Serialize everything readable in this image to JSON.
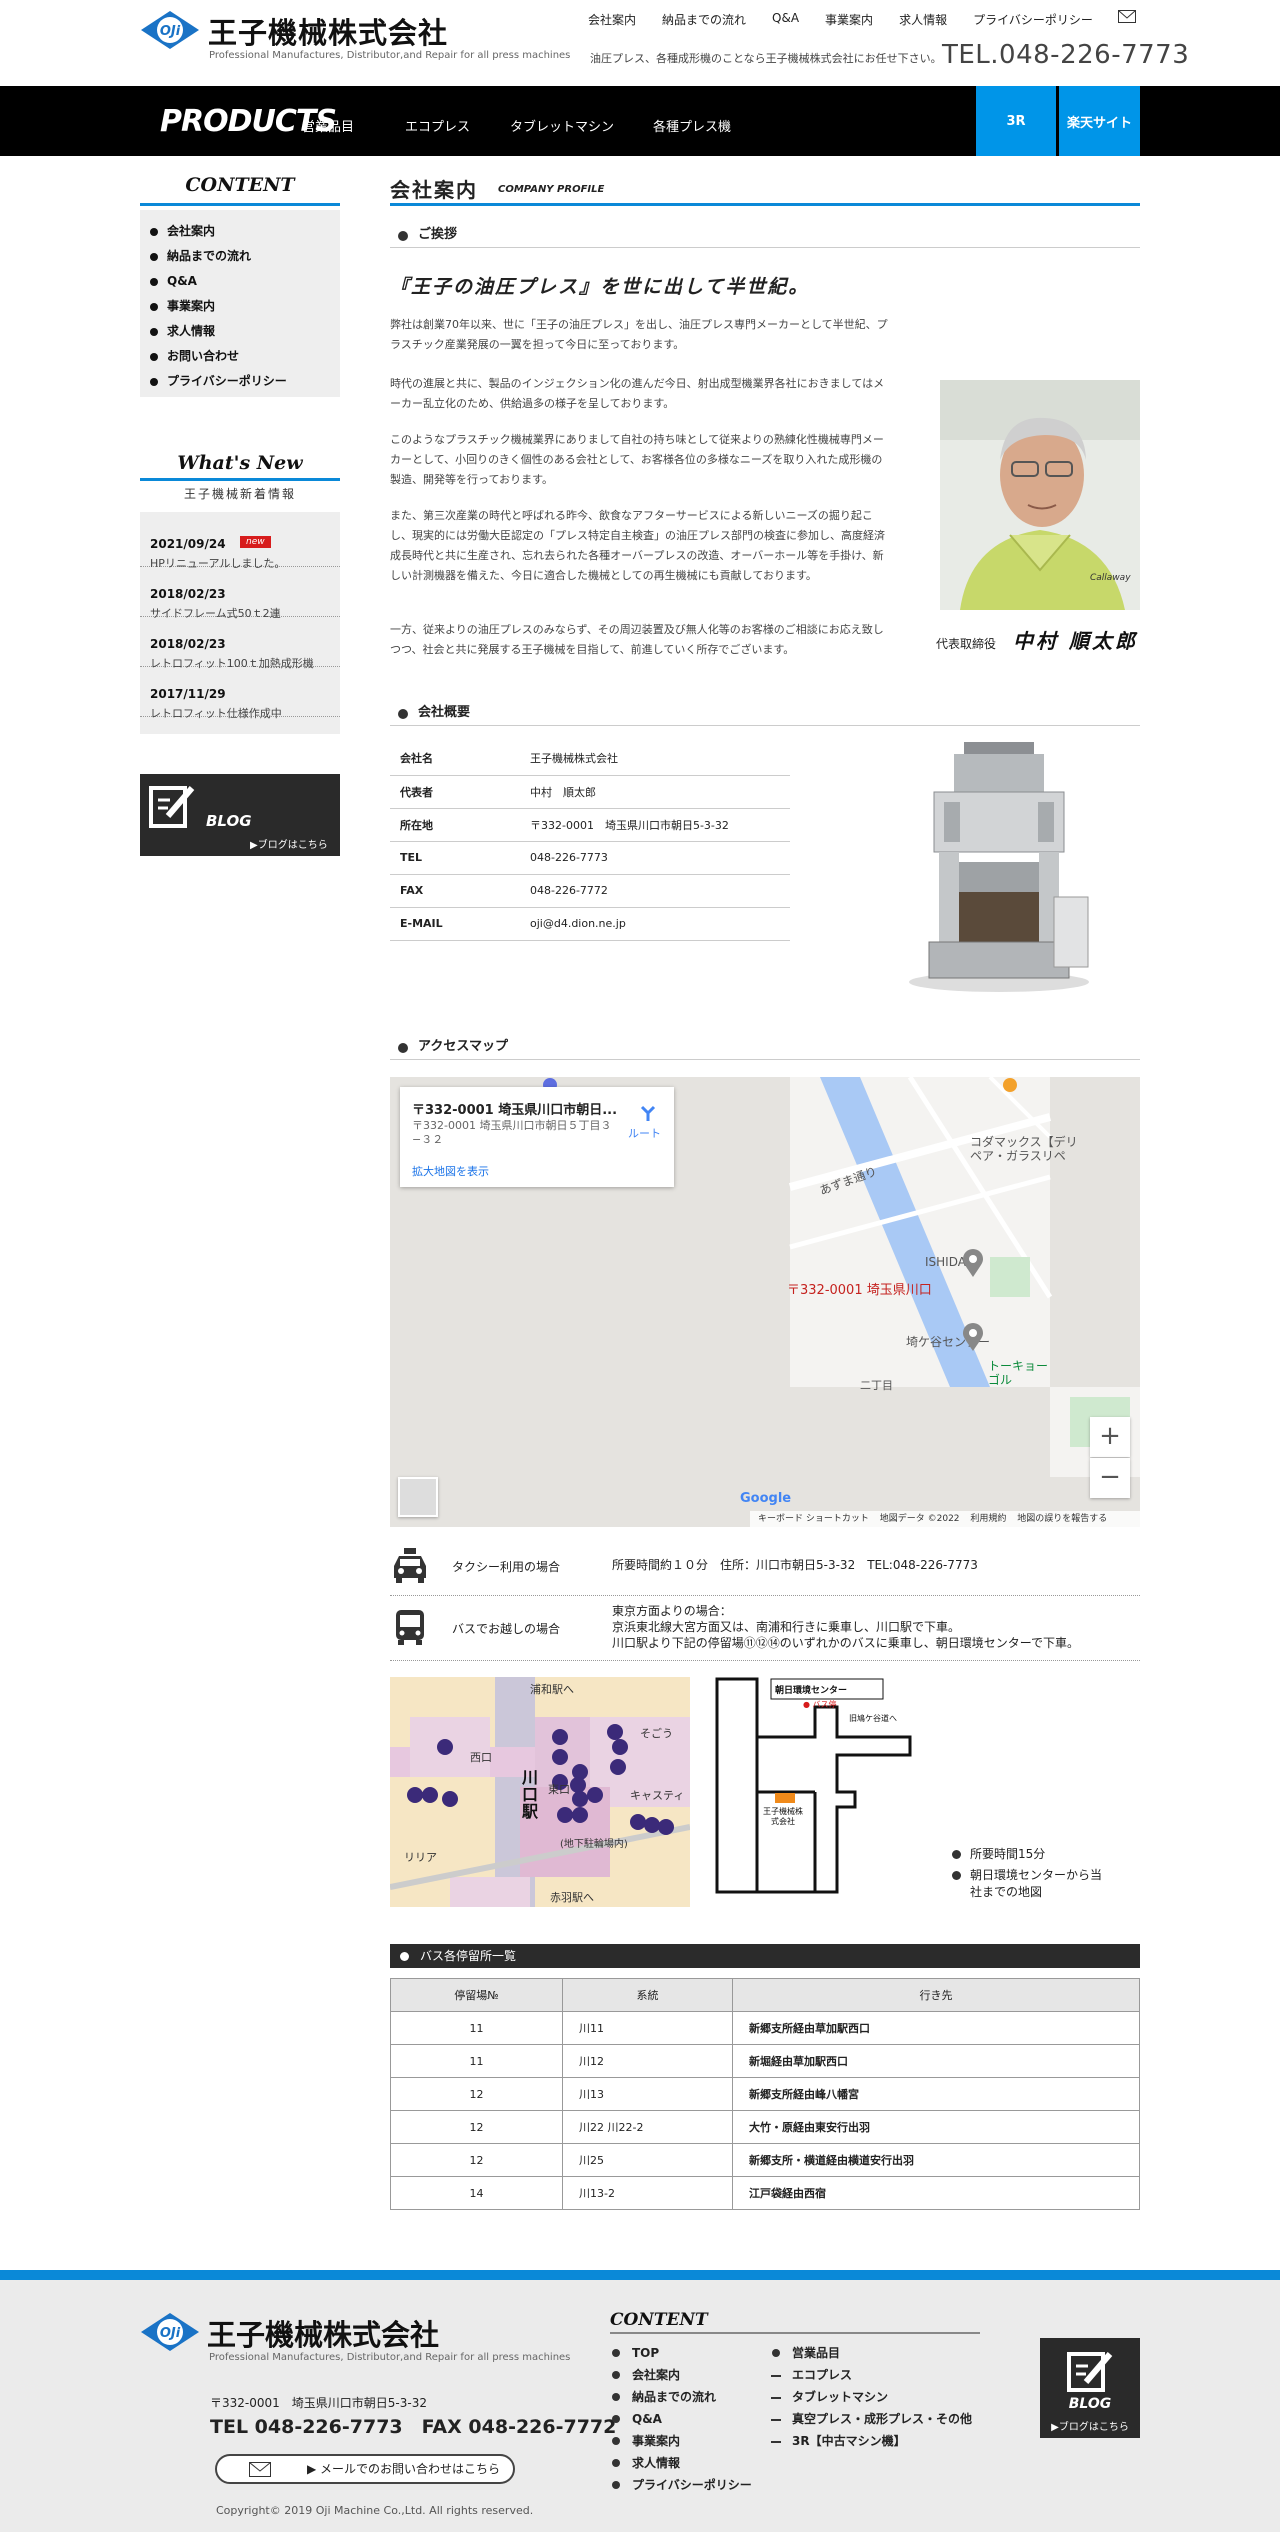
{
  "header": {
    "company_name": "王子機械株式会社",
    "logo_letters": "OJi",
    "tagline_en": "Professional Manufactures, Distributor,and Repair for all press machines",
    "top_nav": [
      "会社案内",
      "納品までの流れ",
      "Q&A",
      "事業案内",
      "求人情報",
      "プライバシーポリシー"
    ],
    "intro": "油圧プレス、各種成形機のことなら王子機械株式会社にお任せ下さい。",
    "tel": "TEL.048-226-7773"
  },
  "navbar": {
    "products": "PRODUCTS",
    "products_sub": "営業品目",
    "items": [
      "エコプレス",
      "タブレットマシン",
      "各種プレス機"
    ],
    "btn_3r": "3R",
    "btn_rakuten": "楽天サイト"
  },
  "sidebar": {
    "content_title": "CONTENT",
    "menu": [
      "会社案内",
      "納品までの流れ",
      "Q&A",
      "事業案内",
      "求人情報",
      "お問い合わせ",
      "プライバシーポリシー"
    ],
    "news_title": "What's New",
    "news_sub": "王子機械新着情報",
    "news": [
      {
        "date": "2021/09/24",
        "title": "HPリニューアルしました。",
        "badge": "new"
      },
      {
        "date": "2018/02/23",
        "title": "サイドフレーム式50ｔ2連",
        "badge": ""
      },
      {
        "date": "2018/02/23",
        "title": "レトロフィット100ｔ加熱成形機",
        "badge": ""
      },
      {
        "date": "2017/11/29",
        "title": "レトロフィット仕様作成中",
        "badge": ""
      }
    ],
    "blog_label": "BLOG",
    "blog_link": "▶ブログはこちら"
  },
  "main": {
    "title": "会社案内",
    "title_sub": "COMPANY PROFILE",
    "greeting_head": "ご挨拶",
    "catch": "『王子の油圧プレス』を世に出して半世紀。",
    "paragraphs": [
      "弊社は創業70年以来、世に「王子の油圧プレス」を出し、油圧プレス専門メーカーとして半世紀、プラスチック産業発展の一翼を担って今日に至っております。",
      "時代の進展と共に、製品のインジェクション化の進んだ今日、射出成型機業界各社におきましてはメーカー乱立化のため、供給過多の様子を呈しております。",
      "このようなプラスチック機械業界にありまして自社の持ち味として従来よりの熟練化性機械専門メーカーとして、小回りのきく個性のある会社として、お客様各位の多様なニーズを取り入れた成形機の製造、開発等を行っております。",
      "また、第三次産業の時代と呼ばれる昨今、飲食なアフターサービスによる新しいニーズの掘り起こし、現実的には労働大臣認定の「プレス特定自主検査」の油圧プレス部門の検査に参加し、高度経済成長時代と共に生産され、忘れ去られた各種オーバープレスの改造、オーバーホール等を手掛け、新しい計測機器を備えた、今日に適合した機械としての再生機械にも貢献しております。",
      "一方、従来よりの油圧プレスのみならず、その周辺装置及び無人化等のお客様のご相談にお応え致しつつ、社会と共に発展する王子機械を目指して、前進していく所存でございます。"
    ],
    "president_label": "代表取締役",
    "president_name": "中村 順太郎",
    "overview_head": "会社概要",
    "overview": [
      {
        "key": "会社名",
        "value": "王子機械株式会社"
      },
      {
        "key": "代表者",
        "value": "中村　順太郎"
      },
      {
        "key": "所在地",
        "value": "〒332-0001　埼玉県川口市朝日5-3-32"
      },
      {
        "key": "TEL",
        "value": "048-226-7773"
      },
      {
        "key": "FAX",
        "value": "048-226-7772"
      },
      {
        "key": "E-MAIL",
        "value": "oji@d4.dion.ne.jp"
      }
    ],
    "access_head": "アクセスマップ",
    "map": {
      "card_title": "〒332-0001 埼玉県川口市朝日...",
      "card_addr": "〒332-0001 埼玉県川口市朝日５丁目３−３２",
      "card_route": "ルート",
      "card_link": "拡大地図を表示",
      "labels": [
        "コダマックス【デリペア・ガラスリペ",
        "あずま通り",
        "ISHIDA",
        "〒332-0001 埼玉県川口",
        "埼ケ谷センター",
        "トーキョーゴル",
        "二丁目"
      ],
      "zoom_in": "+",
      "zoom_out": "−",
      "google": "Google",
      "footer": [
        "キーボード ショートカット",
        "地図データ ©2022",
        "利用規約",
        "地図の誤りを報告する"
      ]
    },
    "taxi_label": "タクシー利用の場合",
    "taxi_text": "所要時間約１０分　住所：川口市朝日5-3-32　TEL:048-226-7773",
    "bus_label": "バスでお越しの場合",
    "bus_text": [
      "東京方面よりの場合：",
      "京浜東北線大宮方面又は、南浦和行きに乗車し、川口駅で下車。",
      "川口駅より下記の停留場⑪⑫⑭のいずれかのバスに乗車し、朝日環境センターで下車。"
    ],
    "station_labels": [
      "浦和駅へ",
      "西口",
      "川口駅",
      "東口",
      "キャスティ",
      "リリア",
      "(地下駐輪場内)",
      "赤羽駅へ",
      "そごう"
    ],
    "bus_map": {
      "center": "朝日環境センター",
      "stop": "● バス停",
      "road": "旧鳩ケ谷道へ",
      "company": "王子機械株式会社"
    },
    "bus_notes": [
      "所要時間15分",
      "朝日環境センターから当社までの地図"
    ],
    "bus_table_head": "バス各停留所一覧",
    "bus_table_cols": [
      "停留場№",
      "系統",
      "行き先"
    ],
    "bus_rows": [
      [
        "11",
        "川11",
        "新郷支所経由草加駅西口"
      ],
      [
        "11",
        "川12",
        "新堀経由草加駅西口"
      ],
      [
        "12",
        "川13",
        "新郷支所経由峰八幡宮"
      ],
      [
        "12",
        "川22 川22-2",
        "大竹・原経由東安行出羽"
      ],
      [
        "12",
        "川25",
        "新郷支所・横道経由横道安行出羽"
      ],
      [
        "14",
        "川13-2",
        "江戸袋経由西宿"
      ]
    ]
  },
  "footer": {
    "company_name": "王子機械株式会社",
    "tagline_en": "Professional Manufactures, Distributor,and Repair for all press machines",
    "address": "〒332-0001　埼玉県川口市朝日5-3-32",
    "tel_fax": "TEL 048-226-7773　FAX 048-226-7772",
    "mail_button": "▶ メールでのお問い合わせはこちら",
    "copyright": "Copyright© 2019 Oji Machine Co.,Ltd. All rights reserved.",
    "content_title": "CONTENT",
    "col1": [
      "TOP",
      "会社案内",
      "納品までの流れ",
      "Q&A",
      "事業案内",
      "求人情報",
      "プライバシーポリシー"
    ],
    "col2_head": "営業品目",
    "col2": [
      "エコプレス",
      "タブレットマシン",
      "真空プレス・成形プレス・その他",
      "3R【中古マシン機】"
    ],
    "blog_label": "BLOG",
    "blog_link": "▶ブログはこちら"
  },
  "colors": {
    "accent": "#0a89d8",
    "nav_btn": "#0095e8",
    "badge": "#d71c1c",
    "dark": "#2a2a2a"
  }
}
